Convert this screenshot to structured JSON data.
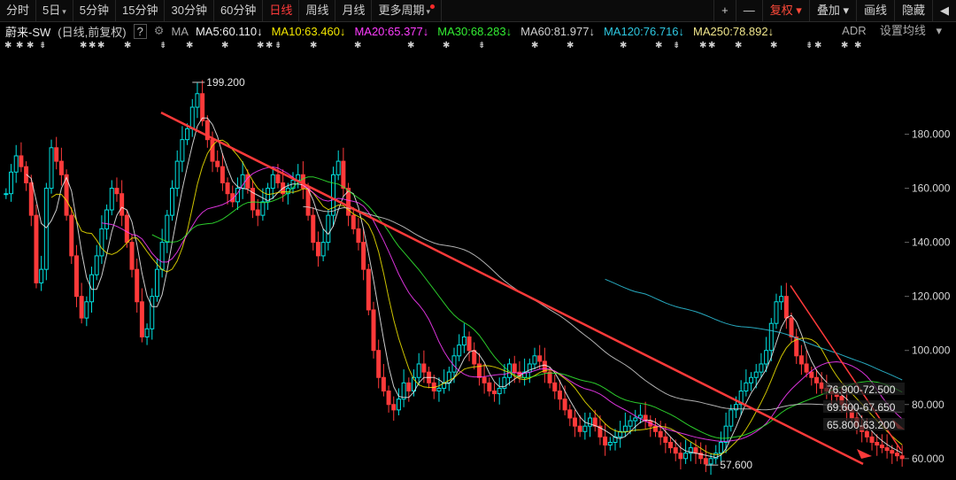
{
  "toolbar": {
    "items": [
      "分时",
      "5日",
      "5分钟",
      "15分钟",
      "30分钟",
      "60分钟",
      "日线",
      "周线",
      "月线",
      "更多周期"
    ],
    "active": "日线",
    "right": [
      "+",
      "—",
      "复权",
      "叠加",
      "画线",
      "隐藏",
      "◀"
    ]
  },
  "ma_bar": {
    "stock": "蔚来-SW",
    "mode": "(日线,前复权)",
    "help": "?",
    "ma_label": "MA",
    "mas": [
      {
        "label": "MA5:60.110",
        "arrow": "↓",
        "color": "#f0f0f0"
      },
      {
        "label": "MA10:63.460",
        "arrow": "↓",
        "color": "#f2e600"
      },
      {
        "label": "MA20:65.377",
        "arrow": "↓",
        "color": "#ff3cff"
      },
      {
        "label": "MA30:68.283",
        "arrow": "↓",
        "color": "#33ee33"
      },
      {
        "label": "MA60:81.977",
        "arrow": "↓",
        "color": "#d0d0d0"
      },
      {
        "label": "MA120:76.716",
        "arrow": "↓",
        "color": "#2ec7e0"
      },
      {
        "label": "MA250:78.892",
        "arrow": "↓",
        "color": "#f0e68c"
      }
    ],
    "adr": "ADR",
    "settings": "设置均线"
  },
  "chart_data": {
    "type": "candlestick",
    "ylim": [
      56,
      210
    ],
    "y_ticks": [
      "180.000",
      "160.000",
      "140.000",
      "120.000",
      "100.000",
      "80.000",
      "60.000"
    ],
    "y_tick_values": [
      180,
      160,
      140,
      120,
      100,
      80,
      60
    ],
    "high_label": "199.200",
    "high_value": 199.2,
    "low_label": "57.600",
    "low_value": 57.6,
    "range_labels": [
      "76.900-72.500",
      "69.600-67.650",
      "65.800-63.200"
    ],
    "closes": [
      158,
      166,
      172,
      168,
      162,
      150,
      125,
      130,
      160,
      175,
      170,
      165,
      150,
      135,
      120,
      112,
      118,
      128,
      135,
      145,
      152,
      160,
      158,
      150,
      140,
      130,
      118,
      105,
      108,
      120,
      130,
      140,
      150,
      160,
      170,
      178,
      182,
      190,
      195,
      185,
      178,
      170,
      168,
      162,
      158,
      155,
      160,
      165,
      160,
      152,
      150,
      155,
      160,
      165,
      162,
      158,
      160,
      163,
      165,
      160,
      150,
      140,
      135,
      140,
      150,
      165,
      170,
      160,
      150,
      145,
      140,
      130,
      115,
      100,
      90,
      85,
      80,
      78,
      82,
      88,
      85,
      90,
      95,
      92,
      88,
      85,
      86,
      88,
      92,
      98,
      102,
      105,
      100,
      95,
      90,
      88,
      85,
      84,
      86,
      90,
      95,
      92,
      90,
      92,
      95,
      98,
      96,
      92,
      88,
      85,
      82,
      78,
      75,
      72,
      70,
      72,
      75,
      72,
      68,
      65,
      66,
      68,
      70,
      72,
      74,
      75,
      76,
      74,
      72,
      70,
      68,
      66,
      64,
      62,
      60,
      62,
      64,
      62,
      60,
      58,
      60,
      62,
      66,
      72,
      78,
      80,
      85,
      88,
      90,
      92,
      95,
      100,
      110,
      118,
      120,
      112,
      105,
      98,
      95,
      92,
      90,
      88,
      86,
      85,
      84,
      83,
      80,
      78,
      75,
      72,
      70,
      68,
      66,
      65,
      64,
      63,
      62,
      61,
      60
    ]
  }
}
